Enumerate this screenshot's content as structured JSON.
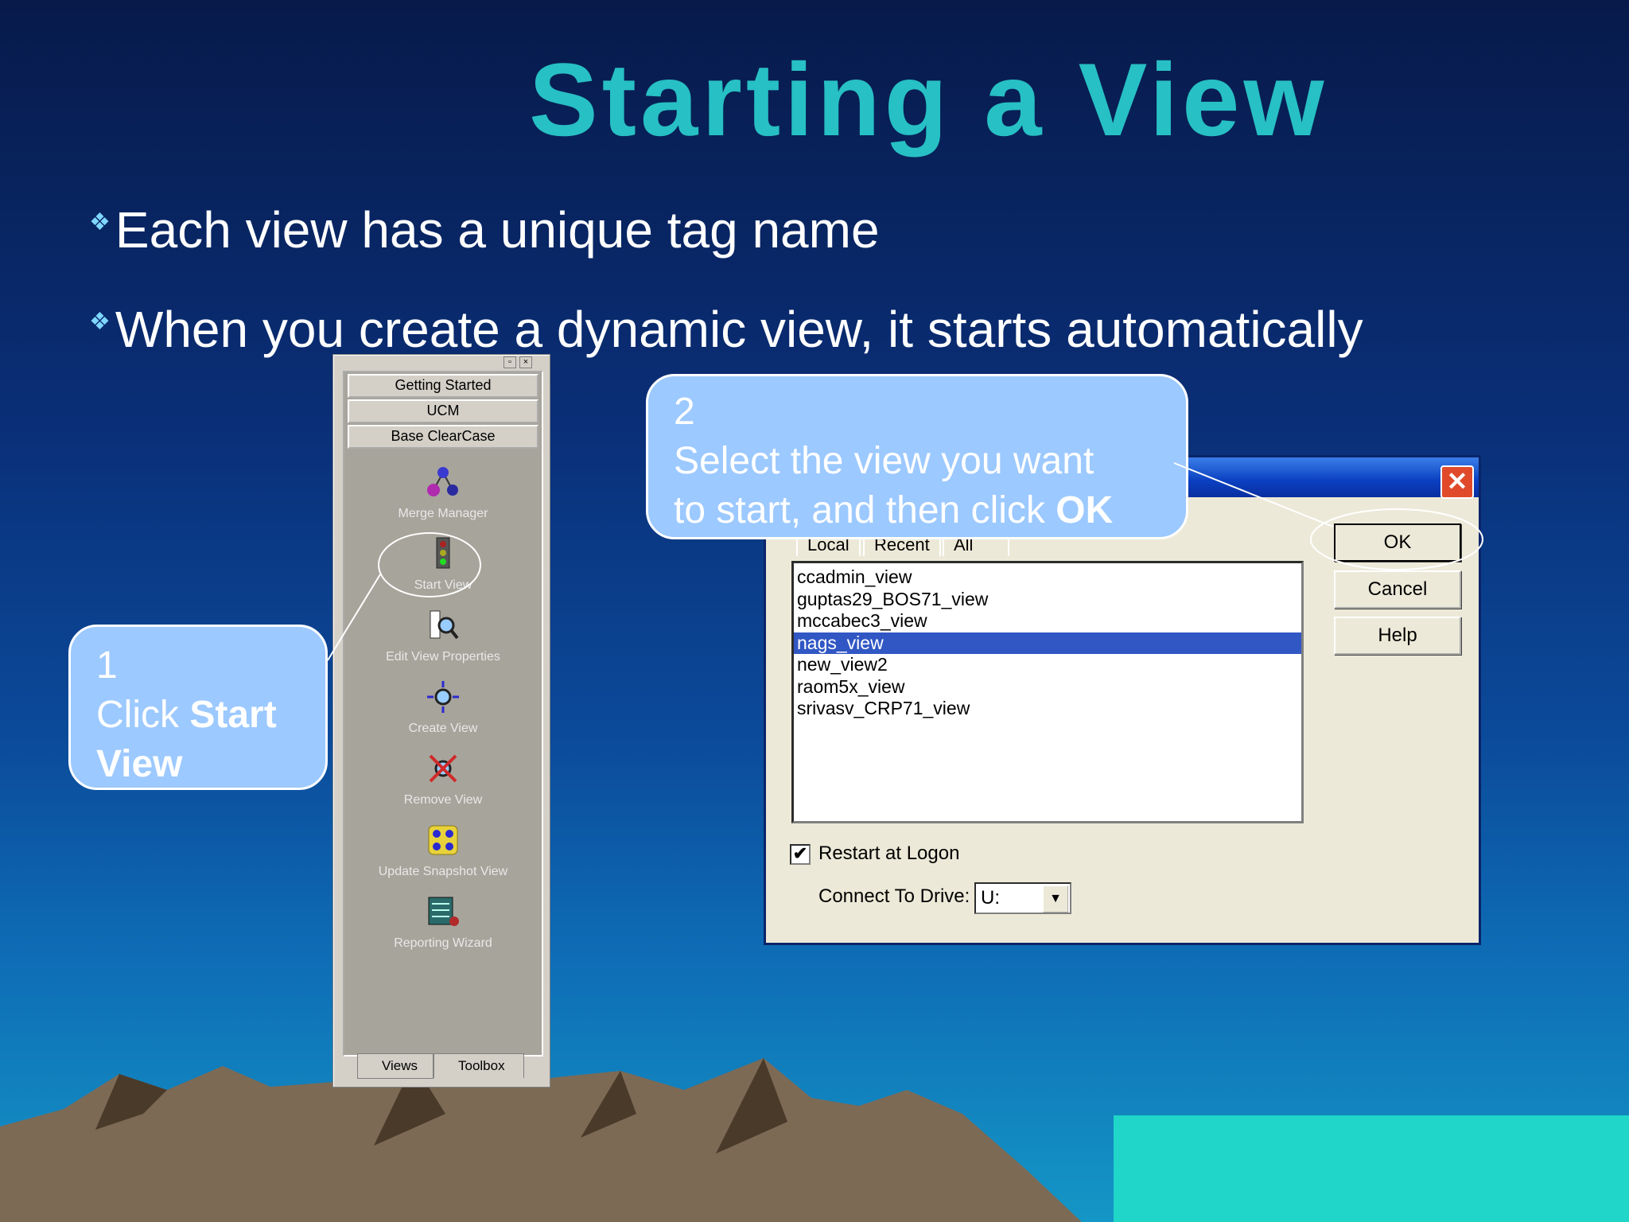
{
  "slide": {
    "title": "Starting a View",
    "bullets": [
      "Each view has a unique tag name",
      "When you create a dynamic view, it starts automatically"
    ],
    "bullet_marker": "❖"
  },
  "toolbox": {
    "titlebar_buttons": [
      "▫",
      "×"
    ],
    "tabs": [
      "Getting Started",
      "UCM",
      "Base ClearCase"
    ],
    "items": [
      {
        "label": "Merge Manager",
        "icon": "merge-manager-icon"
      },
      {
        "label": "Start View",
        "icon": "start-view-icon"
      },
      {
        "label": "Edit View Properties",
        "icon": "edit-view-properties-icon"
      },
      {
        "label": "Create View",
        "icon": "create-view-icon"
      },
      {
        "label": "Remove View",
        "icon": "remove-view-icon"
      },
      {
        "label": "Update Snapshot View",
        "icon": "update-snapshot-view-icon"
      },
      {
        "label": "Reporting Wizard",
        "icon": "reporting-wizard-icon"
      }
    ],
    "bottom_tabs": [
      "Views",
      "Toolbox"
    ]
  },
  "dialog": {
    "close_label": "✕",
    "tabs": [
      "Local",
      "Recent",
      "All"
    ],
    "views": [
      "ccadmin_view",
      "guptas29_BOS71_view",
      "mccabec3_view",
      "nags_view",
      "new_view2",
      "raom5x_view",
      "srivasv_CRP71_view"
    ],
    "selected_view": "nags_view",
    "buttons": {
      "ok": "OK",
      "cancel": "Cancel",
      "help": "Help"
    },
    "restart_at_logon": {
      "label": "Restart at Logon",
      "checked": true,
      "check_mark": "✔"
    },
    "connect_drive": {
      "label": "Connect To Drive:",
      "value": "U:",
      "arrow": "▼"
    }
  },
  "callouts": {
    "step1": {
      "number": "1",
      "text": "Click ",
      "bold": "Start View"
    },
    "step2": {
      "number": "2",
      "line1": "Select the view you want",
      "line2": "to start, and then click ",
      "bold": "OK"
    }
  },
  "colors": {
    "title": "#27c0c4",
    "callout_fill": "#9cc9ff",
    "selection": "#3157c4"
  }
}
